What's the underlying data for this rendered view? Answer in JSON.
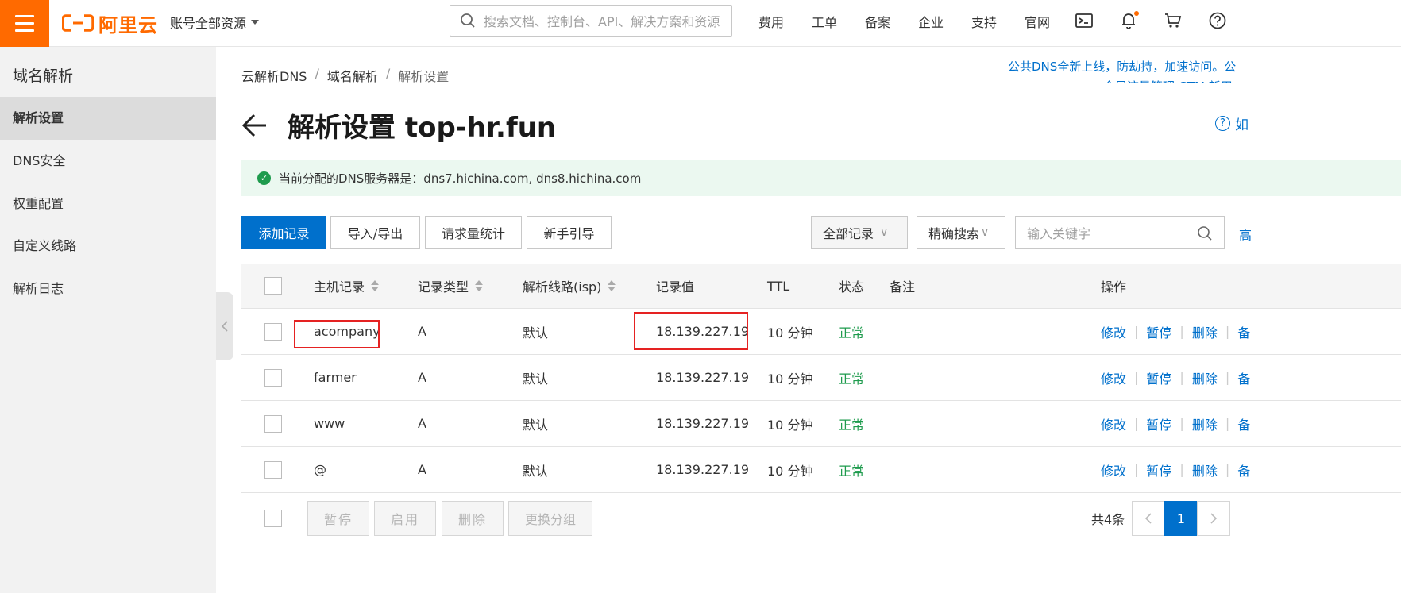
{
  "topbar": {
    "logo_text": "阿里云",
    "account_label": "账号全部资源",
    "search_placeholder": "搜索文档、控制台、API、解决方案和资源",
    "nav": [
      "费用",
      "工单",
      "备案",
      "企业",
      "支持",
      "官网"
    ],
    "icons": [
      "terminal-icon",
      "bell-icon",
      "cart-icon",
      "help-icon"
    ]
  },
  "sidebar": {
    "title": "域名解析",
    "items": [
      {
        "label": "解析设置",
        "active": true
      },
      {
        "label": "DNS安全",
        "active": false
      },
      {
        "label": "权重配置",
        "active": false
      },
      {
        "label": "自定义线路",
        "active": false
      },
      {
        "label": "解析日志",
        "active": false
      }
    ]
  },
  "breadcrumb": [
    "云解析DNS",
    "域名解析",
    "解析设置"
  ],
  "promo": {
    "line1": "公共DNS全新上线，防劫持，加速访问。公",
    "line2": "全局流量管理 GTM 新用..."
  },
  "page_title": "解析设置 top-hr.fun",
  "help_link": "如",
  "notice": "当前分配的DNS服务器是：dns7.hichina.com, dns8.hichina.com",
  "toolbar": {
    "add": "添加记录",
    "import_export": "导入/导出",
    "query_stats": "请求量统计",
    "guide": "新手引导",
    "filter_all": "全部记录",
    "precise_search": "精确搜索",
    "keyword_placeholder": "输入关键字",
    "advanced": "高"
  },
  "table": {
    "headers": {
      "host": "主机记录",
      "type": "记录类型",
      "line": "解析线路(isp)",
      "value": "记录值",
      "ttl": "TTL",
      "status": "状态",
      "remark": "备注",
      "ops": "操作"
    },
    "rows": [
      {
        "host": "acompany",
        "type": "A",
        "line": "默认",
        "value": "18.139.227.19",
        "ttl": "10 分钟",
        "status": "正常",
        "remark": ""
      },
      {
        "host": "farmer",
        "type": "A",
        "line": "默认",
        "value": "18.139.227.19",
        "ttl": "10 分钟",
        "status": "正常",
        "remark": ""
      },
      {
        "host": "www",
        "type": "A",
        "line": "默认",
        "value": "18.139.227.19",
        "ttl": "10 分钟",
        "status": "正常",
        "remark": ""
      },
      {
        "host": "@",
        "type": "A",
        "line": "默认",
        "value": "18.139.227.19",
        "ttl": "10 分钟",
        "status": "正常",
        "remark": ""
      }
    ],
    "row_actions": {
      "edit": "修改",
      "pause": "暂停",
      "delete": "删除",
      "more": "备"
    }
  },
  "footer": {
    "batch_pause": "暂停",
    "batch_enable": "启用",
    "batch_delete": "删除",
    "change_group": "更换分组",
    "total": "共4条",
    "current_page": "1"
  },
  "colors": {
    "brand": "#ff6a00",
    "primary": "#0070cc",
    "success": "#1e9b4d",
    "highlight_box": "#e52222"
  }
}
